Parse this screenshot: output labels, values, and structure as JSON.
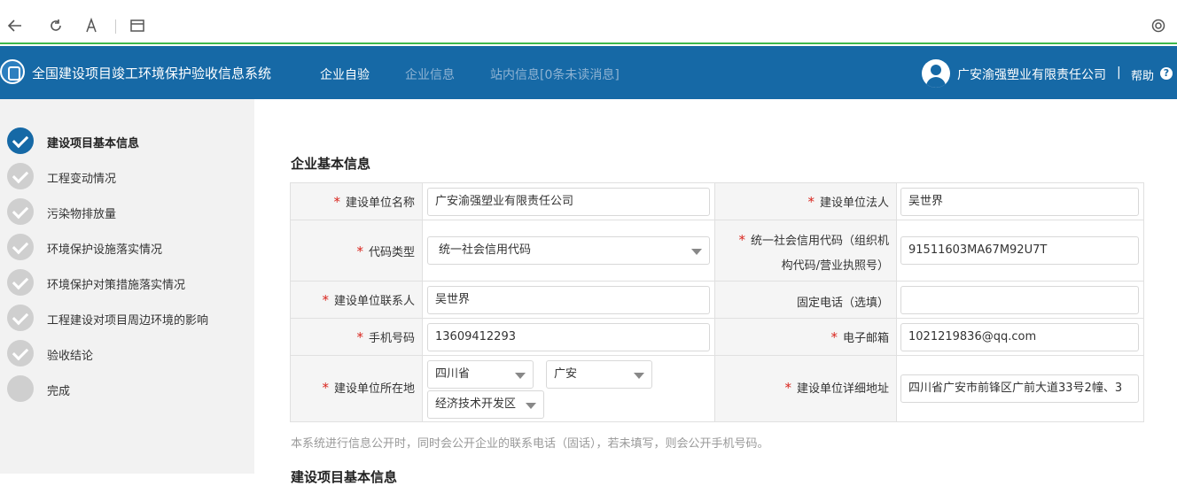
{
  "browser": {
    "icons": [
      "back-icon",
      "refresh-icon",
      "reader-icon",
      "tab-icon",
      "settings-icon"
    ]
  },
  "header": {
    "title": "全国建设项目竣工环境保护验收信息系统",
    "nav": [
      "企业自验",
      "企业信息",
      "站内信息[0条未读消息]"
    ],
    "company": "广安渝强塑业有限责任公司",
    "separator": "|",
    "help": "帮助",
    "help_icon": "?",
    "colors": {
      "header_bg": "#1669a6",
      "nav_dim": "#8fb3d3"
    }
  },
  "sidebar": {
    "steps": [
      {
        "label": "建设项目基本信息",
        "state": "current"
      },
      {
        "label": "工程变动情况",
        "state": "done"
      },
      {
        "label": "污染物排放量",
        "state": "done"
      },
      {
        "label": "环境保护设施落实情况",
        "state": "done"
      },
      {
        "label": "环境保护对策措施落实情况",
        "state": "done"
      },
      {
        "label": "工程建设对项目周边环境的影响",
        "state": "done"
      },
      {
        "label": "验收结论",
        "state": "done"
      },
      {
        "label": "完成",
        "state": "pending"
      }
    ]
  },
  "form": {
    "section_title": "企业基本信息",
    "required_mark": "*",
    "fields": {
      "unit_name": {
        "label": "建设单位名称",
        "value": "广安渝强塑业有限责任公司"
      },
      "legal_person": {
        "label": "建设单位法人",
        "value": "吴世界"
      },
      "code_type": {
        "label": "代码类型",
        "value": "统一社会信用代码"
      },
      "credit_code": {
        "label_line1": "统一社会信用代码（组织机",
        "label_line2": "构代码/营业执照号）",
        "value": "91511603MA67M92U7T"
      },
      "contact": {
        "label": "建设单位联系人",
        "value": "吴世界"
      },
      "phone": {
        "label": "固定电话（选填）",
        "value": ""
      },
      "mobile": {
        "label": "手机号码",
        "value": "13609412293"
      },
      "email": {
        "label": "电子邮箱",
        "value": "1021219836@qq.com"
      },
      "location": {
        "label": "建设单位所在地",
        "province": "四川省",
        "city": "广安",
        "district": "经济技术开发区"
      },
      "address": {
        "label": "建设单位详细地址",
        "value": "四川省广安市前锋区广前大道33号2幢、3"
      }
    },
    "note": "本系统进行信息公开时，同时会公开企业的联系电话（固话），若未填写，则会公开手机号码。",
    "next_section": "建设项目基本信息"
  }
}
